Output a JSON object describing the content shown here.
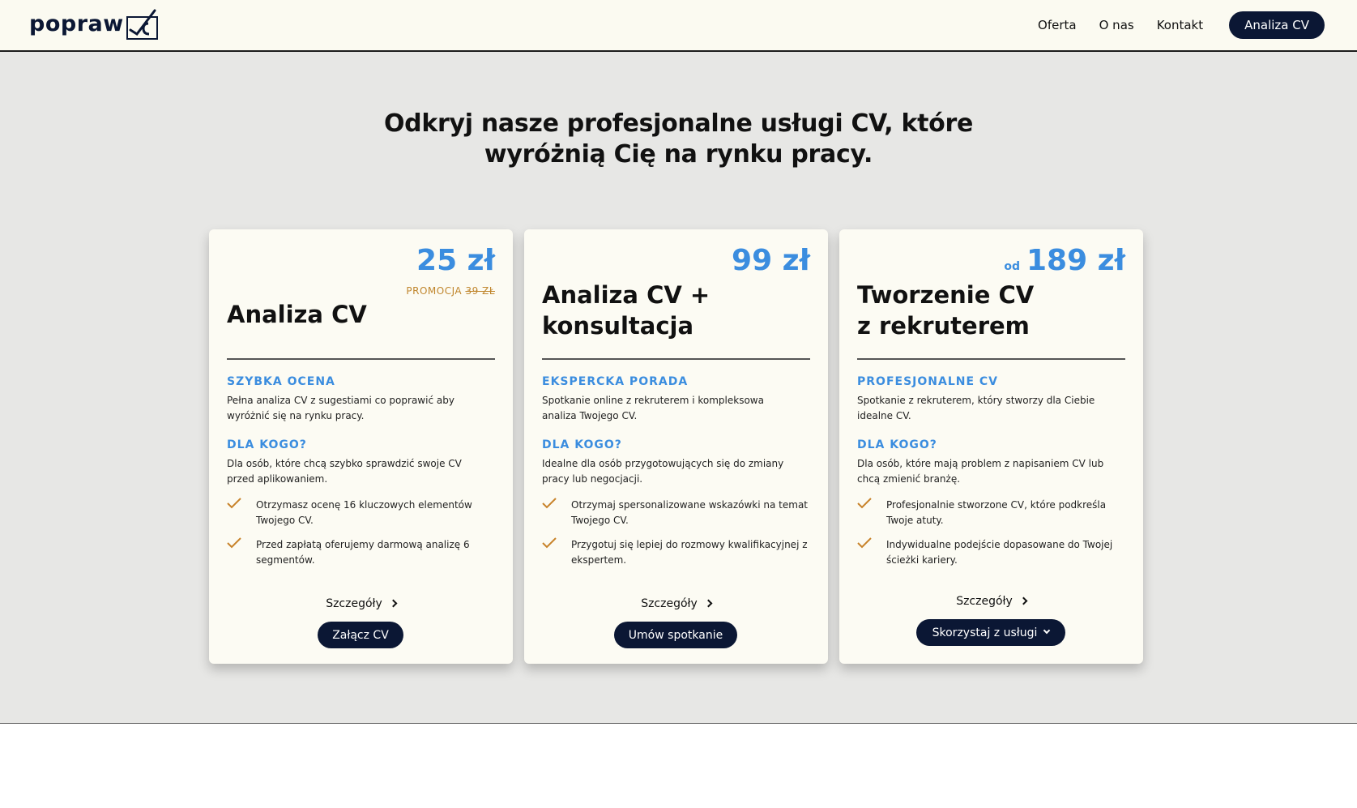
{
  "header": {
    "logo": {
      "text": "popraw",
      "badge": "cv"
    },
    "nav": [
      {
        "label": "Oferta"
      },
      {
        "label": "O nas"
      },
      {
        "label": "Kontakt"
      }
    ],
    "cta_label": "Analiza CV"
  },
  "hero": {
    "title_line1": "Odkryj nasze profesjonalne usługi CV, które",
    "title_line2": "wyróżnią Cię na rynku pracy."
  },
  "cards": [
    {
      "price": "25 zł",
      "promo_label": "PROMOCJA",
      "promo_old_price": "39 ZŁ",
      "title": "Analiza CV",
      "section1_label": "SZYBKA OCENA",
      "section1_text": "Pełna analiza CV z sugestiami co poprawić aby wyróżnić się na rynku pracy.",
      "section2_label": "DLA KOGO?",
      "section2_text": "Dla osób, które chcą szybko sprawdzić swoje CV przed aplikowaniem.",
      "benefits": [
        "Otrzymasz ocenę 16 kluczowych elementów Twojego CV.",
        "Przed zapłatą oferujemy darmową analizę 6 segmentów."
      ],
      "details_label": "Szczegóły",
      "button_label": "Załącz CV"
    },
    {
      "price": "99 zł",
      "title_line1": "Analiza CV +",
      "title_line2": "konsultacja",
      "section1_label": "EKSPERCKA PORADA",
      "section1_text": "Spotkanie online z rekruterem i kompleksowa analiza Twojego CV.",
      "section2_label": "DLA KOGO?",
      "section2_text": "Idealne dla osób przygotowujących się do zmiany pracy lub negocjacji.",
      "benefits": [
        "Otrzymaj spersonalizowane wskazówki na temat Twojego CV.",
        "Przygotuj się lepiej do rozmowy kwalifikacyjnej z ekspertem."
      ],
      "details_label": "Szczegóły",
      "button_label": "Umów spotkanie"
    },
    {
      "price_prefix": "od",
      "price": "189 zł",
      "title_line1": "Tworzenie CV",
      "title_line2": "z rekruterem",
      "section1_label": "PROFESJONALNE CV",
      "section1_text": "Spotkanie z rekruterem, który stworzy dla Ciebie idealne CV.",
      "section2_label": "DLA KOGO?",
      "section2_text": "Dla osób, które mają problem z napisaniem CV lub chcą zmienić branżę.",
      "benefits": [
        "Profesjonalnie stworzone CV, które podkreśla Twoje atuty.",
        "Indywidualne podejście dopasowane do Twojej ścieżki kariery."
      ],
      "details_label": "Szczegóły",
      "button_label": "Skorzystaj z usługi"
    }
  ],
  "colors": {
    "navy": "#0b1734",
    "accent_blue": "#3b8ddf",
    "promo_orange": "#c0862d",
    "check_orange": "#c8832a",
    "header_bg": "#fbfaf1",
    "section_bg": "#e7e7e5",
    "card_bg": "#fcfbf3"
  }
}
